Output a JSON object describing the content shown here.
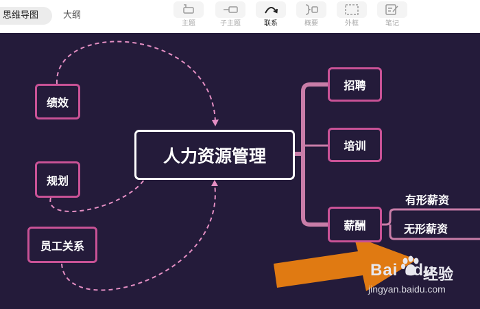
{
  "view_tabs": {
    "mindmap": "思维导图",
    "outline": "大纲"
  },
  "toolbar": {
    "topic": "主题",
    "subtopic": "子主题",
    "relation": "联系",
    "summary": "概要",
    "boundary": "外框",
    "note": "笔记"
  },
  "mindmap": {
    "center": "人力资源管理",
    "branches": [
      "招聘",
      "培训",
      "薪酬"
    ],
    "salary_children": [
      "有形薪资",
      "无形薪资"
    ],
    "floating": [
      "绩效",
      "规划",
      "员工关系"
    ]
  },
  "colors": {
    "canvas_bg": "#241b3a",
    "node_border": "#c95296",
    "branch_line": "#c97da8",
    "relation_line": "#e58fc4",
    "arrow": "#e07a12"
  },
  "watermark": {
    "logo": "Bai",
    "logo_suffix": "du",
    "brand": "经验",
    "url": "jingyan.baidu.com"
  }
}
